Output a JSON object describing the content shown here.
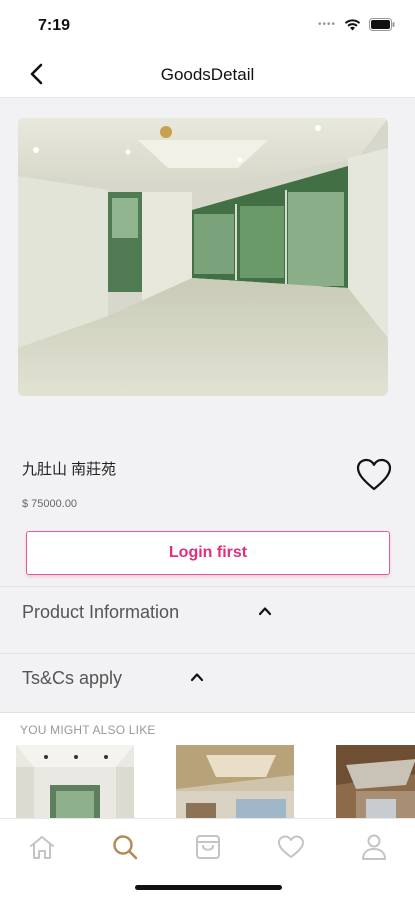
{
  "status": {
    "time": "7:19"
  },
  "nav": {
    "title": "GoodsDetail"
  },
  "product": {
    "name": "九肚山 南莊苑",
    "price": "$ 75000.00"
  },
  "actions": {
    "login_label": "Login first"
  },
  "sections": [
    {
      "title": "Product Information"
    },
    {
      "title": "Ts&Cs apply"
    }
  ],
  "recommend": {
    "title": "YOU MIGHT ALSO LIKE"
  },
  "tabs": [
    {
      "icon": "home-icon"
    },
    {
      "icon": "search-icon"
    },
    {
      "icon": "cart-icon"
    },
    {
      "icon": "heart-icon"
    },
    {
      "icon": "profile-icon"
    }
  ],
  "colors": {
    "accent": "#e0307b",
    "tab_active": "#b28a55",
    "tab_inactive": "#c4c4c4"
  }
}
